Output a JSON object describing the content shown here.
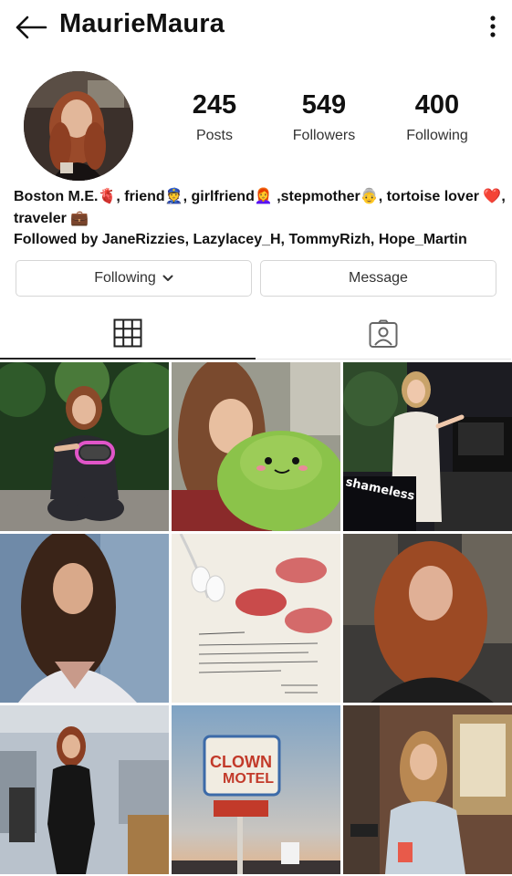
{
  "header": {
    "username": "MaurieMaura",
    "back_icon": "arrow-left-icon",
    "more_icon": "more-vertical-icon"
  },
  "stats": {
    "posts": {
      "value": "245",
      "label": "Posts"
    },
    "followers": {
      "value": "549",
      "label": "Followers"
    },
    "following": {
      "value": "400",
      "label": "Following"
    }
  },
  "bio": {
    "line": "Boston M.E.🫀, friend👮, girlfriend👩‍🦰 ,stepmother👵, tortoise lover ❤️, traveler 💼",
    "followed_by": "Followed by JaneRizzies, Lazylacey_H, TommyRizh, Hope_Martin"
  },
  "actions": {
    "following_label": "Following",
    "message_label": "Message"
  },
  "tabs": {
    "grid_icon": "grid-icon",
    "tagged_icon": "tagged-person-icon"
  },
  "posts": {
    "shameless_text": "shameless",
    "motel_sign_top": "CLOWN",
    "motel_sign_bottom": "MOTEL"
  },
  "colors": {
    "text": "#111111",
    "border": "#d6d6d6",
    "tab_active": "#222222"
  }
}
